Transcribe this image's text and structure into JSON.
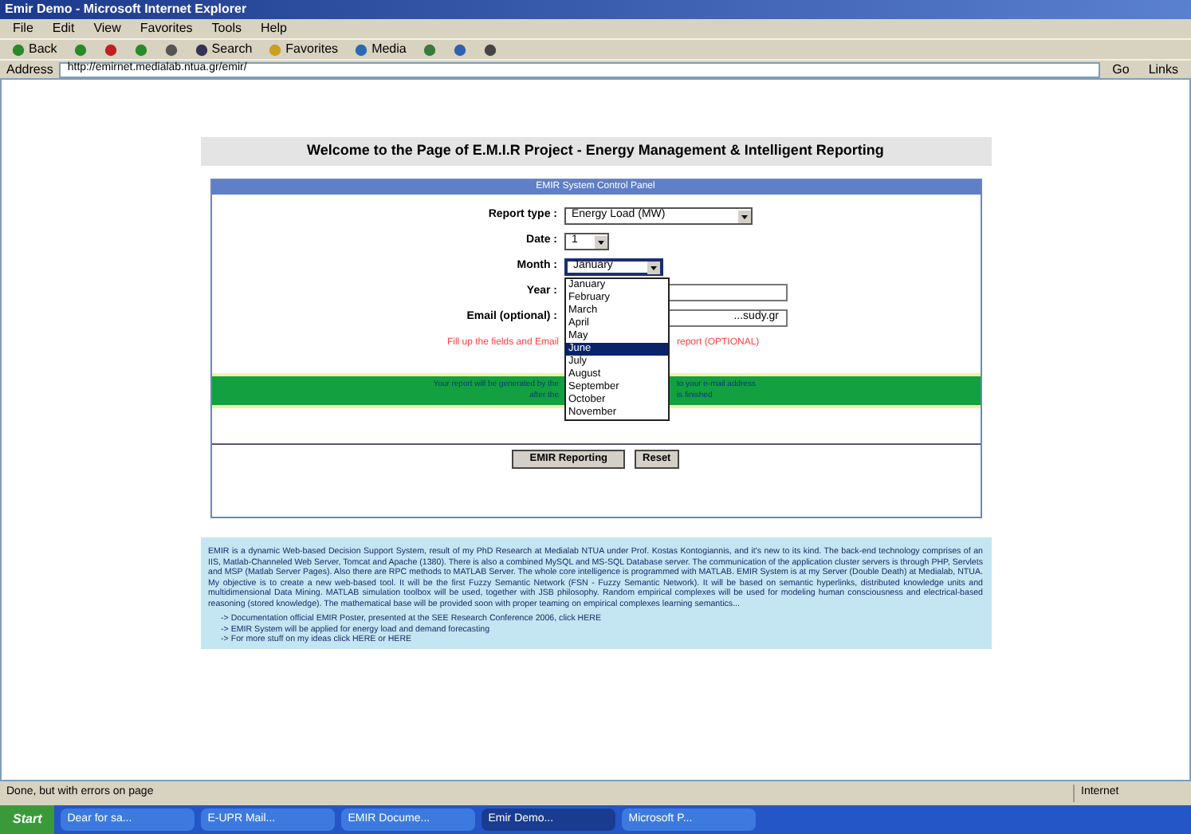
{
  "window": {
    "title": "Emir Demo - Microsoft Internet Explorer"
  },
  "menu": [
    "File",
    "Edit",
    "View",
    "Favorites",
    "Tools",
    "Help"
  ],
  "toolbar": [
    {
      "kind": "back",
      "label": "Back"
    },
    {
      "kind": "forward"
    },
    {
      "kind": "stop"
    },
    {
      "kind": "refresh"
    },
    {
      "kind": "home"
    },
    {
      "kind": "search",
      "label": "Search"
    },
    {
      "kind": "favorites",
      "label": "Favorites"
    },
    {
      "kind": "media",
      "label": "Media"
    },
    {
      "kind": "history"
    },
    {
      "kind": "mail"
    },
    {
      "kind": "print"
    }
  ],
  "address": {
    "label": "Address",
    "url": "http://emirnet.medialab.ntua.gr/emir/",
    "go": "Go",
    "links": "Links"
  },
  "page": {
    "heading": "Welcome to the Page of E.M.I.R Project - Energy Management & Intelligent Reporting",
    "panel_title": "EMIR System Control Panel",
    "fields": [
      {
        "kind": "select",
        "label": "Report type :",
        "value": "Energy Load (MW)"
      },
      {
        "kind": "select",
        "label": "Date :",
        "value": "1"
      },
      {
        "kind": "select",
        "label": "Month :",
        "value": "January",
        "open": true
      },
      {
        "kind": "input",
        "label": "Year :"
      },
      {
        "kind": "input",
        "label": "Email (optional) :",
        "value": "...sudy.gr"
      }
    ],
    "month_options": [
      {
        "label": "January",
        "selected": false
      },
      {
        "label": "February",
        "selected": false
      },
      {
        "label": "March",
        "selected": false
      },
      {
        "label": "April",
        "selected": false
      },
      {
        "label": "May",
        "selected": false
      },
      {
        "label": "June",
        "selected": true
      },
      {
        "label": "July",
        "selected": false
      },
      {
        "label": "August",
        "selected": false
      },
      {
        "label": "September",
        "selected": false
      },
      {
        "label": "October",
        "selected": false
      },
      {
        "label": "November",
        "selected": false
      }
    ],
    "warning": [
      "Fill up the fields and Email",
      "report (OPTIONAL)"
    ],
    "notice": [
      [
        "Your report will be generated by the",
        "to your e-mail address"
      ],
      [
        "after the",
        "is finished"
      ]
    ],
    "buttons": [
      "EMIR Reporting",
      "Reset"
    ],
    "info": [
      {
        "kind": "text",
        "text": "EMIR is a dynamic Web-based Decision Support System, result of my PhD Research at Medialab NTUA under Prof. Kostas Kontogiannis, and it's new to its kind. The back-end technology comprises of an IIS, Matlab-Channeled Web Server, Tomcat and Apache (1380). There is also a combined MySQL and MS-SQL Database server. The communication of the application cluster servers is through PHP, Servlets and MSP (Matlab Server Pages). Also there are RPC methods to MATLAB Server. The whole core intelligence is programmed with MATLAB. EMIR System is at my Server (Double Death) at Medialab, NTUA. My objective is to create a new web-based tool. It will be the first Fuzzy Semantic Network (FSN - Fuzzy Semantic Network). It will be based on semantic hyperlinks, distributed knowledge units and multidimensional Data Mining. MATLAB simulation toolbox will be used, together with JSB philosophy. Random empirical complexes will be used for modeling human consciousness and electrical-based reasoning (stored knowledge). The mathematical base will be provided soon with proper teaming on empirical complexes learning semantics..."
      },
      {
        "kind": "bullet",
        "text": "-> Documentation official EMIR Poster, presented at the SEE Research Conference 2006, click HERE"
      },
      {
        "kind": "bullet",
        "text": "-> EMIR System will be applied for energy load and demand forecasting"
      },
      {
        "kind": "bullet",
        "text": "-> For more stuff on my ideas click HERE or HERE"
      }
    ]
  },
  "status": {
    "text": "Done, but with errors on page",
    "zone": "Internet"
  },
  "taskbar": {
    "start": "Start",
    "tasks": [
      {
        "label": "Dear for sa...",
        "selected": false
      },
      {
        "label": "E-UPR Mail...",
        "selected": false
      },
      {
        "label": "EMIR Docume...",
        "selected": false
      },
      {
        "label": "Emir Demo...",
        "selected": true
      },
      {
        "label": "Microsoft P...",
        "selected": false
      }
    ]
  }
}
